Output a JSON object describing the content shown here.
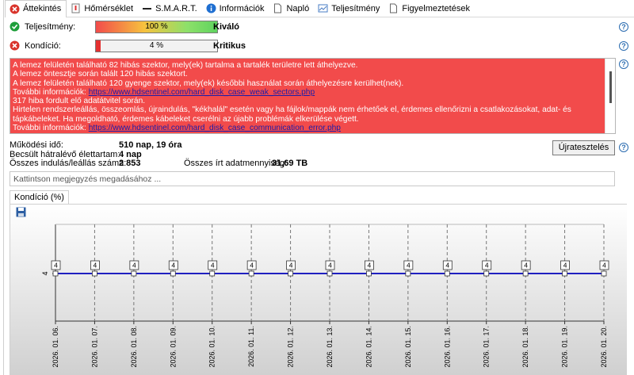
{
  "tabs": [
    {
      "label": "Áttekintés",
      "icon": "error-icon",
      "active": true
    },
    {
      "label": "Hőmérséklet",
      "icon": "thermometer-icon"
    },
    {
      "label": "S.M.A.R.T.",
      "icon": "dash-icon"
    },
    {
      "label": "Információk",
      "icon": "info-icon"
    },
    {
      "label": "Napló",
      "icon": "document-icon"
    },
    {
      "label": "Teljesítmény",
      "icon": "chart-icon"
    },
    {
      "label": "Figyelmeztetések",
      "icon": "document-icon"
    }
  ],
  "performance": {
    "label": "Teljesítmény:",
    "value_text": "100 %",
    "fraction": 1.0,
    "verdict": "Kiváló",
    "bar_color": "#5fd35f"
  },
  "condition": {
    "label": "Kondíció:",
    "value_text": "4 %",
    "fraction": 0.04,
    "verdict": "Kritikus",
    "bar_color": "#e53030"
  },
  "message": {
    "lines": [
      "A lemez felületén található 82 hibás szektor, mely(ek) tartalma a tartalék területre lett áthelyezve.",
      "A lemez öntesztje során talált 120 hibás szektort.",
      "A lemez felületén található 120 gyenge szektor, mely(ek) későbbi használat során áthelyezésre kerülhet(nek)."
    ],
    "more1_label": "További információk:",
    "more1_link": "https://www.hdsentinel.com/hard_disk_case_weak_sectors.php",
    "line4": "317 hiba fordult elő adatátvitel során.",
    "line5": "Hirtelen rendszerleállás, összeomlás, újraindulás, \"kékhalál\" esetén vagy ha fájlok/mappák nem érhetőek el, érdemes ellenőrizni a csatlakozásokat, adat- és tápkábeleket. Ha megoldható, érdemes kábeleket cserélni az újabb problémák elkerülése végett.",
    "more2_label": "További információk:",
    "more2_link": "https://www.hdsentinel.com/hard_disk_case_communication_error.php"
  },
  "info": {
    "uptime_label": "Működési idő:",
    "uptime_value": "510 nap, 19 óra",
    "remaining_label": "Becsült hátralévő élettartam:",
    "remaining_value": "4 nap",
    "starts_label": "Összes indulás/leállás száma:",
    "starts_value": "2 853",
    "written_label": "Összes írt adatmennyiség:",
    "written_value": "31,69 TB"
  },
  "retest_label": "Újratesztelés",
  "note_placeholder": "Kattintson megjegyzés megadásához ...",
  "chart_tab_label": "Kondíció  (%)",
  "chart_data": {
    "type": "line",
    "x": [
      "2026. 01. 06.",
      "2026. 01. 07.",
      "2026. 01. 08.",
      "2026. 01. 09.",
      "2026. 01. 10.",
      "2026. 01. 11.",
      "2026. 01. 12.",
      "2026. 01. 13.",
      "2026. 01. 14.",
      "2026. 01. 15.",
      "2026. 01. 16.",
      "2026. 01. 17.",
      "2026. 01. 18.",
      "2026. 01. 19.",
      "2026. 01. 20."
    ],
    "series": [
      {
        "values": [
          4,
          4,
          4,
          4,
          4,
          4,
          4,
          4,
          4,
          4,
          4,
          4,
          4,
          4,
          4
        ],
        "color": "#2020c0"
      }
    ],
    "y_tick": "4",
    "data_label_text": "4",
    "grid": true
  }
}
